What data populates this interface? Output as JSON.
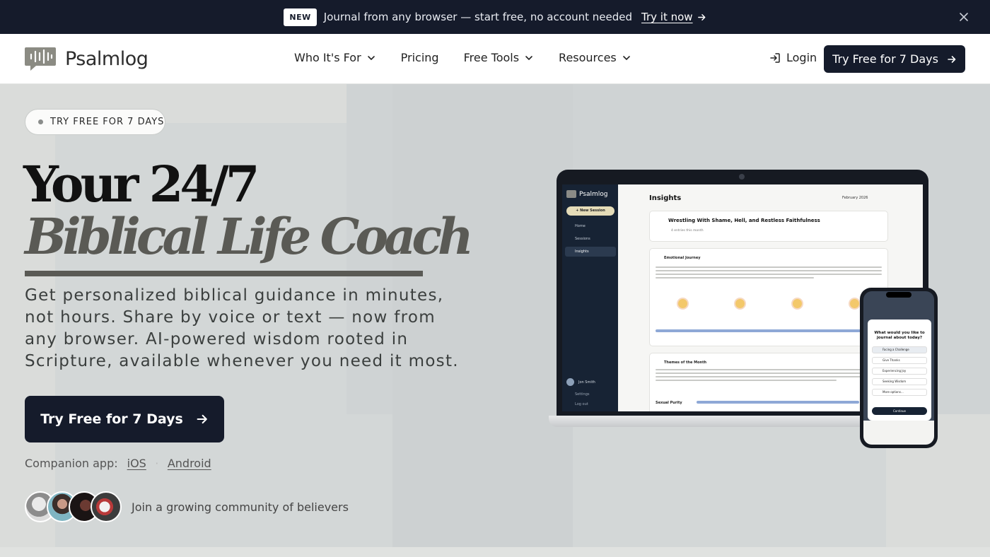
{
  "announcement": {
    "badge": "NEW",
    "message": "Journal from any browser — start free, no account needed",
    "cta": "Try it now"
  },
  "nav": {
    "brand": "Psalmlog",
    "menu": [
      {
        "label": "Who It's For",
        "dropdown": true
      },
      {
        "label": "Pricing",
        "dropdown": false
      },
      {
        "label": "Free Tools",
        "dropdown": true
      },
      {
        "label": "Resources",
        "dropdown": true
      }
    ],
    "login": "Login",
    "cta": "Try Free for 7 Days"
  },
  "hero": {
    "pill": "TRY FREE FOR 7 DAYS",
    "headline_line1": "Your 24/7",
    "headline_line2": "Biblical Life Coach",
    "subtext": "Get personalized biblical guidance in minutes, not hours. Share by voice or text — now from any browser. AI-powered wisdom rooted in Scripture, available whenever you need it most.",
    "cta": "Try Free for 7 Days",
    "companion_label": "Companion app:",
    "companion_links": [
      "iOS",
      "Android"
    ],
    "community_text": "Join a growing community of believers"
  },
  "mockup": {
    "laptop": {
      "brand": "Psalmlog",
      "new_session": "+ New Session",
      "nav": [
        "Home",
        "Sessions",
        "Insights"
      ],
      "user": "Jon Smith",
      "footer": [
        "Settings",
        "Log out"
      ],
      "page_title": "Insights",
      "month": "February 2026",
      "summary_title": "Wrestling With Shame, Hell, and Restless Faithfulness",
      "summary_sub": "4 entries this month",
      "emotional_journey": "Emotional Journey",
      "themes": "Themes of the Month",
      "theme_item": "Sexual Purity"
    },
    "phone": {
      "question": "What would you like to journal about today?",
      "options": [
        "Facing a Challenge",
        "Give Thanks",
        "Experiencing Joy",
        "Seeking Wisdom",
        "More options..."
      ],
      "continue": "Continue"
    }
  },
  "colors": {
    "primary": "#151b2b",
    "hero_bg": "#dadcda",
    "accent_muted": "#5a5a55"
  }
}
